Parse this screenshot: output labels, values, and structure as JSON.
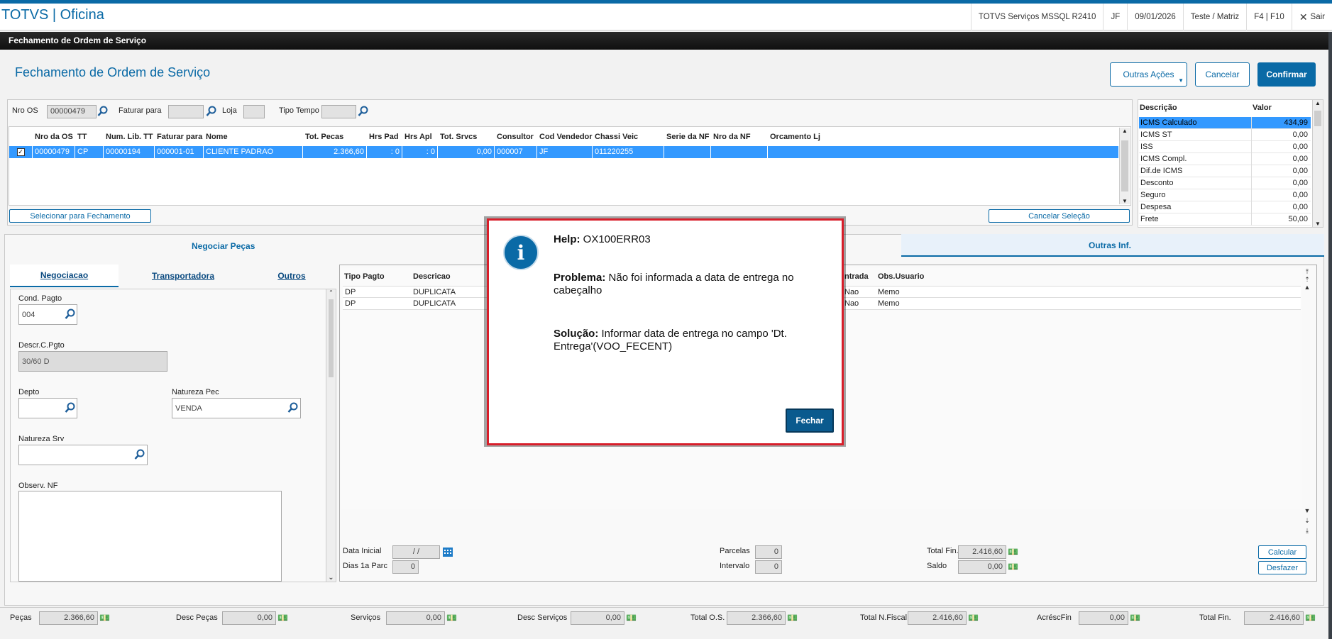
{
  "app_title": "TOTVS | Oficina",
  "top_info": {
    "env": "TOTVS Serviços MSSQL R2410",
    "branch": "JF",
    "date": "09/01/2026",
    "company": "Teste / Matriz",
    "shortcuts": "F4 | F10",
    "exit": "Sair"
  },
  "window_title": "Fechamento de Ordem de Serviço",
  "page_title": "Fechamento de Ordem de Serviço",
  "actions": {
    "more": "Outras Ações",
    "cancel": "Cancelar",
    "confirm": "Confirmar"
  },
  "filters": {
    "nro_os_label": "Nro OS",
    "nro_os_value": "00000479",
    "faturar_label": "Faturar para",
    "loja_label": "Loja",
    "tipo_tempo_label": "Tipo Tempo"
  },
  "os_table": {
    "headers": [
      "Nro da OS",
      "TT",
      "Num. Lib. TT",
      "Faturar para",
      "Nome",
      "Tot. Pecas",
      "Hrs Pad",
      "Hrs Apl",
      "Tot. Srvcs",
      "Consultor",
      "Cod Vendedor",
      "Chassi Veic",
      "Serie da NF",
      "Nro da NF",
      "Orcamento Lj"
    ],
    "row": [
      "00000479",
      "CP",
      "00000194",
      "000001-01",
      "CLIENTE PADRAO",
      "2.366,60",
      ": 0",
      ": 0",
      "0,00",
      "000007",
      "JF",
      "011220255",
      "",
      "",
      ""
    ],
    "select_btn": "Selecionar para Fechamento",
    "cancel_sel_btn": "Cancelar Seleção"
  },
  "tax_table": {
    "headers": [
      "Descrição",
      "Valor"
    ],
    "rows": [
      [
        "ICMS Calculado",
        "434,99"
      ],
      [
        "ICMS ST",
        "0,00"
      ],
      [
        "ISS",
        "0,00"
      ],
      [
        "ICMS Compl.",
        "0,00"
      ],
      [
        "Dif.de ICMS",
        "0,00"
      ],
      [
        "Desconto",
        "0,00"
      ],
      [
        "Seguro",
        "0,00"
      ],
      [
        "Despesa",
        "0,00"
      ],
      [
        "Frete",
        "50,00"
      ]
    ]
  },
  "tabs": {
    "negociar": "Negociar Peças",
    "outras": "Outras Inf."
  },
  "subtabs": {
    "neg": "Negociacao",
    "transp": "Transportadora",
    "outros": "Outros"
  },
  "form": {
    "cond_label": "Cond. Pagto",
    "cond_value": "004",
    "descr_label": "Descr.C.Pgto",
    "descr_value": "30/60 D",
    "depto_label": "Depto",
    "natpec_label": "Natureza Pec",
    "natpec_value": "VENDA",
    "natsrv_label": "Natureza Srv",
    "obs_label": "Observ. NF"
  },
  "pay_table": {
    "headers": {
      "tipo": "Tipo Pagto",
      "descr": "Descricao",
      "entrada": "ntrada",
      "obs": "Obs.Usuario"
    },
    "rows": [
      {
        "tipo": "DP",
        "descr": "DUPLICATA",
        "entrada": "Nao",
        "obs": "Memo"
      },
      {
        "tipo": "DP",
        "descr": "DUPLICATA",
        "entrada": "Nao",
        "obs": "Memo"
      }
    ]
  },
  "pay_bottom": {
    "data_ini_label": "Data Inicial",
    "data_ini_value": " /  /",
    "dias_label": "Dias 1a Parc",
    "dias_value": "0",
    "parcelas_label": "Parcelas",
    "parcelas_value": "0",
    "intervalo_label": "Intervalo",
    "intervalo_value": "0",
    "totalfin_label": "Total Fin.",
    "totalfin_value": "2.416,60",
    "saldo_label": "Saldo",
    "saldo_value": "0,00",
    "calc_btn": "Calcular",
    "undo_btn": "Desfazer"
  },
  "footer": [
    {
      "label": "Peças",
      "value": "2.366,60"
    },
    {
      "label": "Desc Peças",
      "value": "0,00"
    },
    {
      "label": "Serviços",
      "value": "0,00"
    },
    {
      "label": "Desc Serviços",
      "value": "0,00"
    },
    {
      "label": "Total O.S.",
      "value": "2.366,60"
    },
    {
      "label": "Total N.Fiscal",
      "value": "2.416,60"
    },
    {
      "label": "AcréscFin",
      "value": "0,00"
    },
    {
      "label": "Total Fin.",
      "value": "2.416,60"
    }
  ],
  "dialog": {
    "help_label": "Help:",
    "help_code": "OX100ERR03",
    "problem_label": "Problema:",
    "problem_text": "Não foi informada a data de entrega no cabeçalho",
    "solution_label": "Solução:",
    "solution_text": "Informar data de entrega no campo 'Dt. Entrega'(VOO_FECENT)",
    "close": "Fechar"
  }
}
